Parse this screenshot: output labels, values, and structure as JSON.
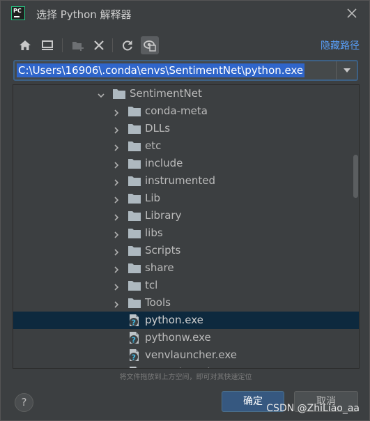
{
  "window": {
    "title": "选择 Python 解释器",
    "logo_text": "PC"
  },
  "toolbar": {
    "buttons": [
      {
        "name": "home-icon",
        "active": false
      },
      {
        "name": "desktop-icon",
        "active": false
      },
      {
        "name": "new-folder-icon",
        "active": false
      },
      {
        "name": "delete-icon",
        "active": false
      },
      {
        "name": "refresh-icon",
        "active": false
      },
      {
        "name": "show-hidden-icon",
        "active": true
      }
    ],
    "hide_path_label": "隐藏路径"
  },
  "path_field": {
    "value": "C:\\Users\\16906\\.conda\\envs\\SentimentNet\\python.exe"
  },
  "tree": {
    "rows": [
      {
        "label": "SentimentNet",
        "type": "folder",
        "level": 0,
        "expanded": true,
        "selected": false
      },
      {
        "label": "conda-meta",
        "type": "folder",
        "level": 1,
        "expanded": false,
        "selected": false
      },
      {
        "label": "DLLs",
        "type": "folder",
        "level": 1,
        "expanded": false,
        "selected": false
      },
      {
        "label": "etc",
        "type": "folder",
        "level": 1,
        "expanded": false,
        "selected": false
      },
      {
        "label": "include",
        "type": "folder",
        "level": 1,
        "expanded": false,
        "selected": false
      },
      {
        "label": "instrumented",
        "type": "folder",
        "level": 1,
        "expanded": false,
        "selected": false
      },
      {
        "label": "Lib",
        "type": "folder",
        "level": 1,
        "expanded": false,
        "selected": false
      },
      {
        "label": "Library",
        "type": "folder",
        "level": 1,
        "expanded": false,
        "selected": false
      },
      {
        "label": "libs",
        "type": "folder",
        "level": 1,
        "expanded": false,
        "selected": false
      },
      {
        "label": "Scripts",
        "type": "folder",
        "level": 1,
        "expanded": false,
        "selected": false
      },
      {
        "label": "share",
        "type": "folder",
        "level": 1,
        "expanded": false,
        "selected": false
      },
      {
        "label": "tcl",
        "type": "folder",
        "level": 1,
        "expanded": false,
        "selected": false
      },
      {
        "label": "Tools",
        "type": "folder",
        "level": 1,
        "expanded": false,
        "selected": false
      },
      {
        "label": "python.exe",
        "type": "file",
        "level": 1,
        "selected": true
      },
      {
        "label": "pythonw.exe",
        "type": "file",
        "level": 1,
        "selected": false
      },
      {
        "label": "venvlauncher.exe",
        "type": "file",
        "level": 1,
        "selected": false
      },
      {
        "label": "venvwlauncher.exe",
        "type": "file",
        "level": 1,
        "selected": false
      }
    ]
  },
  "drag_hint": "将文件拖放到上方空间，即可对其快速定位",
  "buttons": {
    "help_label": "?",
    "ok_label": "确定",
    "cancel_label": "取消"
  },
  "watermark": "CSDN @ZhiLiao_aa",
  "colors": {
    "background": "#3c3f41",
    "selection": "#0d293e",
    "accent_link": "#589df6",
    "path_highlight": "#2f65ca",
    "folder": "#aeb9c0",
    "file_badge": "#40b6e0"
  }
}
